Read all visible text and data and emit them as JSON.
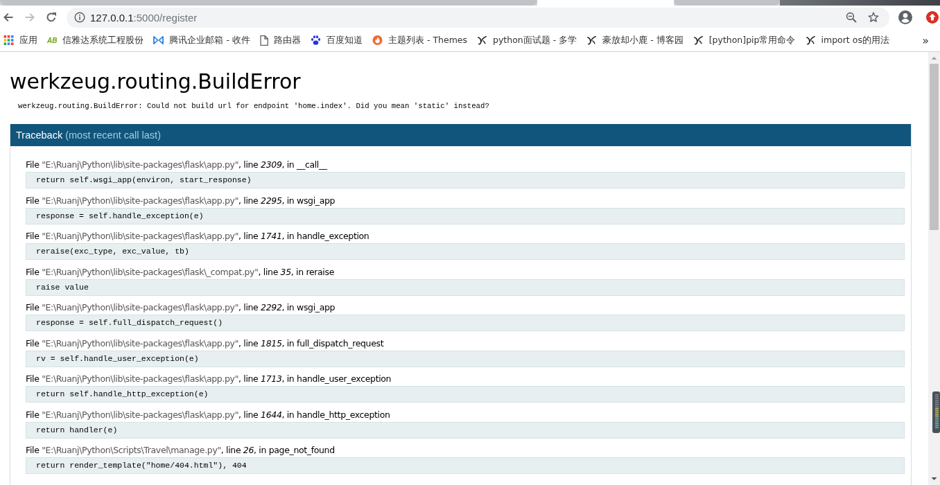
{
  "tabs": [
    {
      "selected": false
    },
    {
      "selected": true
    },
    {
      "selected": false
    }
  ],
  "navigation": [
    {
      "kind": "back",
      "disabled": false
    },
    {
      "kind": "forward",
      "disabled": true
    },
    {
      "kind": "reload",
      "disabled": false
    }
  ],
  "address_bar": {
    "host": "127.0.0.1",
    "path": ":5000/register"
  },
  "bookmarks": [
    {
      "kind": "apps",
      "label": "应用"
    },
    {
      "kind": "ab",
      "badge": "AB",
      "label": "信雅达系统工程股份"
    },
    {
      "kind": "bowtie",
      "label": "腾讯企业邮箱 - 收件"
    },
    {
      "kind": "page",
      "label": "路由器"
    },
    {
      "kind": "paw",
      "label": "百度知道"
    },
    {
      "kind": "flame",
      "label": "主题列表 - Themes"
    },
    {
      "kind": "swirl",
      "label": "python面试题 - 多学"
    },
    {
      "kind": "swirl",
      "label": "豪放却小鹿 - 博客园"
    },
    {
      "kind": "swirl",
      "label": "[python]pip常用命令"
    },
    {
      "kind": "swirl",
      "label": "import os的用法"
    }
  ],
  "bookmarks_overflow": "»",
  "page": {
    "title": "werkzeug.routing.BuildError",
    "message": "werkzeug.routing.BuildError: Could not build url for endpoint 'home.index'. Did you mean 'static' instead?",
    "traceback": {
      "title": "Traceback",
      "subtitle": "(most recent call last)",
      "frames": [
        {
          "file_word": "File",
          "filename": "\"E:\\Ruanj\\Python\\lib\\site-packages\\flask\\app.py\"",
          "line_word": ", line",
          "line": "2309",
          "in_word": ", in",
          "function": "__call__",
          "code": "return self.wsgi_app(environ, start_response)"
        },
        {
          "file_word": "File",
          "filename": "\"E:\\Ruanj\\Python\\lib\\site-packages\\flask\\app.py\"",
          "line_word": ", line",
          "line": "2295",
          "in_word": ", in",
          "function": "wsgi_app",
          "code": "response = self.handle_exception(e)"
        },
        {
          "file_word": "File",
          "filename": "\"E:\\Ruanj\\Python\\lib\\site-packages\\flask\\app.py\"",
          "line_word": ", line",
          "line": "1741",
          "in_word": ", in",
          "function": "handle_exception",
          "code": "reraise(exc_type, exc_value, tb)"
        },
        {
          "file_word": "File",
          "filename": "\"E:\\Ruanj\\Python\\lib\\site-packages\\flask\\_compat.py\"",
          "line_word": ", line",
          "line": "35",
          "in_word": ", in",
          "function": "reraise",
          "code": "raise value"
        },
        {
          "file_word": "File",
          "filename": "\"E:\\Ruanj\\Python\\lib\\site-packages\\flask\\app.py\"",
          "line_word": ", line",
          "line": "2292",
          "in_word": ", in",
          "function": "wsgi_app",
          "code": "response = self.full_dispatch_request()"
        },
        {
          "file_word": "File",
          "filename": "\"E:\\Ruanj\\Python\\lib\\site-packages\\flask\\app.py\"",
          "line_word": ", line",
          "line": "1815",
          "in_word": ", in",
          "function": "full_dispatch_request",
          "code": "rv = self.handle_user_exception(e)"
        },
        {
          "file_word": "File",
          "filename": "\"E:\\Ruanj\\Python\\lib\\site-packages\\flask\\app.py\"",
          "line_word": ", line",
          "line": "1713",
          "in_word": ", in",
          "function": "handle_user_exception",
          "code": "return self.handle_http_exception(e)"
        },
        {
          "file_word": "File",
          "filename": "\"E:\\Ruanj\\Python\\lib\\site-packages\\flask\\app.py\"",
          "line_word": ", line",
          "line": "1644",
          "in_word": ", in",
          "function": "handle_http_exception",
          "code": "return handler(e)"
        },
        {
          "file_word": "File",
          "filename": "\"E:\\Ruanj\\Python\\Scripts\\Travel\\manage.py\"",
          "line_word": ", line",
          "line": "26",
          "in_word": ", in",
          "function": "page_not_found",
          "code": "return render_template(\"home/404.html\"), 404"
        }
      ]
    }
  }
}
